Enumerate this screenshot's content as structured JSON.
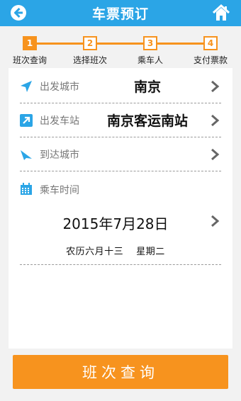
{
  "header": {
    "title": "车票预订",
    "back_icon": "back-arrow-icon",
    "home_icon": "home-icon",
    "color": "#2ba5e6"
  },
  "stepper": {
    "steps": [
      {
        "num": "1",
        "label": "班次查询",
        "active": true
      },
      {
        "num": "2",
        "label": "选择班次",
        "active": false
      },
      {
        "num": "3",
        "label": "乘车人",
        "active": false
      },
      {
        "num": "4",
        "label": "支付票款",
        "active": false
      }
    ],
    "accent": "#f7931e"
  },
  "form": {
    "departure_city": {
      "label": "出发城市",
      "value": "南京",
      "icon": "location-arrow-icon"
    },
    "departure_station": {
      "label": "出发车站",
      "value": "南京客运南站",
      "icon": "external-link-icon"
    },
    "arrival_city": {
      "label": "到达城市",
      "value": "",
      "icon": "plane-arrow-icon"
    },
    "travel_date": {
      "label": "乘车时间",
      "icon": "calendar-icon",
      "date": "2015年7月28日",
      "lunar": "农历六月十三　 星期二"
    }
  },
  "query_button": {
    "label": "班次查询",
    "color": "#f7931e"
  }
}
